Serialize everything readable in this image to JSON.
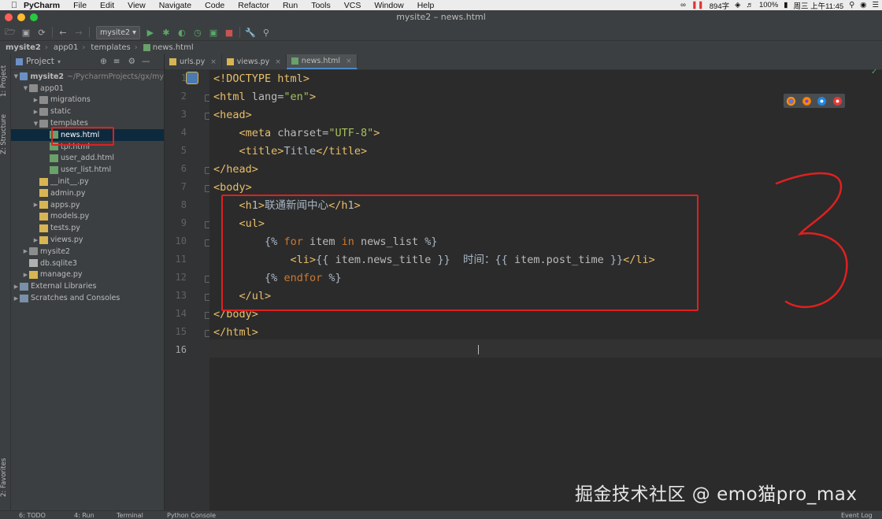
{
  "menubar": {
    "app": "PyCharm",
    "items": [
      "File",
      "Edit",
      "View",
      "Navigate",
      "Code",
      "Refactor",
      "Run",
      "Tools",
      "VCS",
      "Window",
      "Help"
    ],
    "status_count": "894字",
    "battery": "100%",
    "clock": "周三 上午11:45"
  },
  "window": {
    "title": "mysite2 – news.html"
  },
  "toolbar": {
    "run_config": "mysite2"
  },
  "breadcrumb": [
    "mysite2",
    "app01",
    "templates",
    "news.html"
  ],
  "project_pane": {
    "header": "Project",
    "tree": [
      {
        "label": "mysite2",
        "path": "~/PycharmProjects/gx/my",
        "depth": 0,
        "expanded": true,
        "type": "folder"
      },
      {
        "label": "app01",
        "depth": 1,
        "expanded": true,
        "type": "folder"
      },
      {
        "label": "migrations",
        "depth": 2,
        "expanded": false,
        "type": "folder"
      },
      {
        "label": "static",
        "depth": 2,
        "expanded": false,
        "type": "folder"
      },
      {
        "label": "templates",
        "depth": 2,
        "expanded": true,
        "type": "folder"
      },
      {
        "label": "news.html",
        "depth": 3,
        "type": "html",
        "selected": true
      },
      {
        "label": "tpl.html",
        "depth": 3,
        "type": "html"
      },
      {
        "label": "user_add.html",
        "depth": 3,
        "type": "html"
      },
      {
        "label": "user_list.html",
        "depth": 3,
        "type": "html"
      },
      {
        "label": "__init__.py",
        "depth": 2,
        "type": "py"
      },
      {
        "label": "admin.py",
        "depth": 2,
        "type": "py"
      },
      {
        "label": "apps.py",
        "depth": 2,
        "expanded": false,
        "type": "py"
      },
      {
        "label": "models.py",
        "depth": 2,
        "type": "py"
      },
      {
        "label": "tests.py",
        "depth": 2,
        "type": "py"
      },
      {
        "label": "views.py",
        "depth": 2,
        "expanded": false,
        "type": "py"
      },
      {
        "label": "mysite2",
        "depth": 1,
        "expanded": false,
        "type": "folder"
      },
      {
        "label": "db.sqlite3",
        "depth": 1,
        "type": "db"
      },
      {
        "label": "manage.py",
        "depth": 1,
        "expanded": false,
        "type": "py"
      },
      {
        "label": "External Libraries",
        "depth": 0,
        "expanded": false,
        "type": "lib"
      },
      {
        "label": "Scratches and Consoles",
        "depth": 0,
        "expanded": false,
        "type": "lib"
      }
    ]
  },
  "side_tabs": {
    "project": "1: Project",
    "structure": "Z: Structure",
    "favorites": "2: Favorites"
  },
  "editor": {
    "tabs": [
      {
        "label": "urls.py",
        "active": false
      },
      {
        "label": "views.py",
        "active": false
      },
      {
        "label": "news.html",
        "active": true
      }
    ],
    "current_line": 16,
    "lines": [
      "<!DOCTYPE html>",
      "<html lang=\"en\">",
      "<head>",
      "    <meta charset=\"UTF-8\">",
      "    <title>Title</title>",
      "</head>",
      "<body>",
      "    <h1>联通新闻中心</h1>",
      "    <ul>",
      "        {% for item in news_list %}",
      "            <li>{{ item.news_title }}  时间：{{ item.post_time }}</li>",
      "        {% endfor %}",
      "    </ul>",
      "</body>",
      "</html>",
      ""
    ]
  },
  "bottom_tabs": [
    "6: TODO",
    "4: Run",
    "Terminal",
    "Python Console"
  ],
  "event_log": "Event Log",
  "watermark": "掘金技术社区 @ emo猫pro_max",
  "annotation": "3"
}
